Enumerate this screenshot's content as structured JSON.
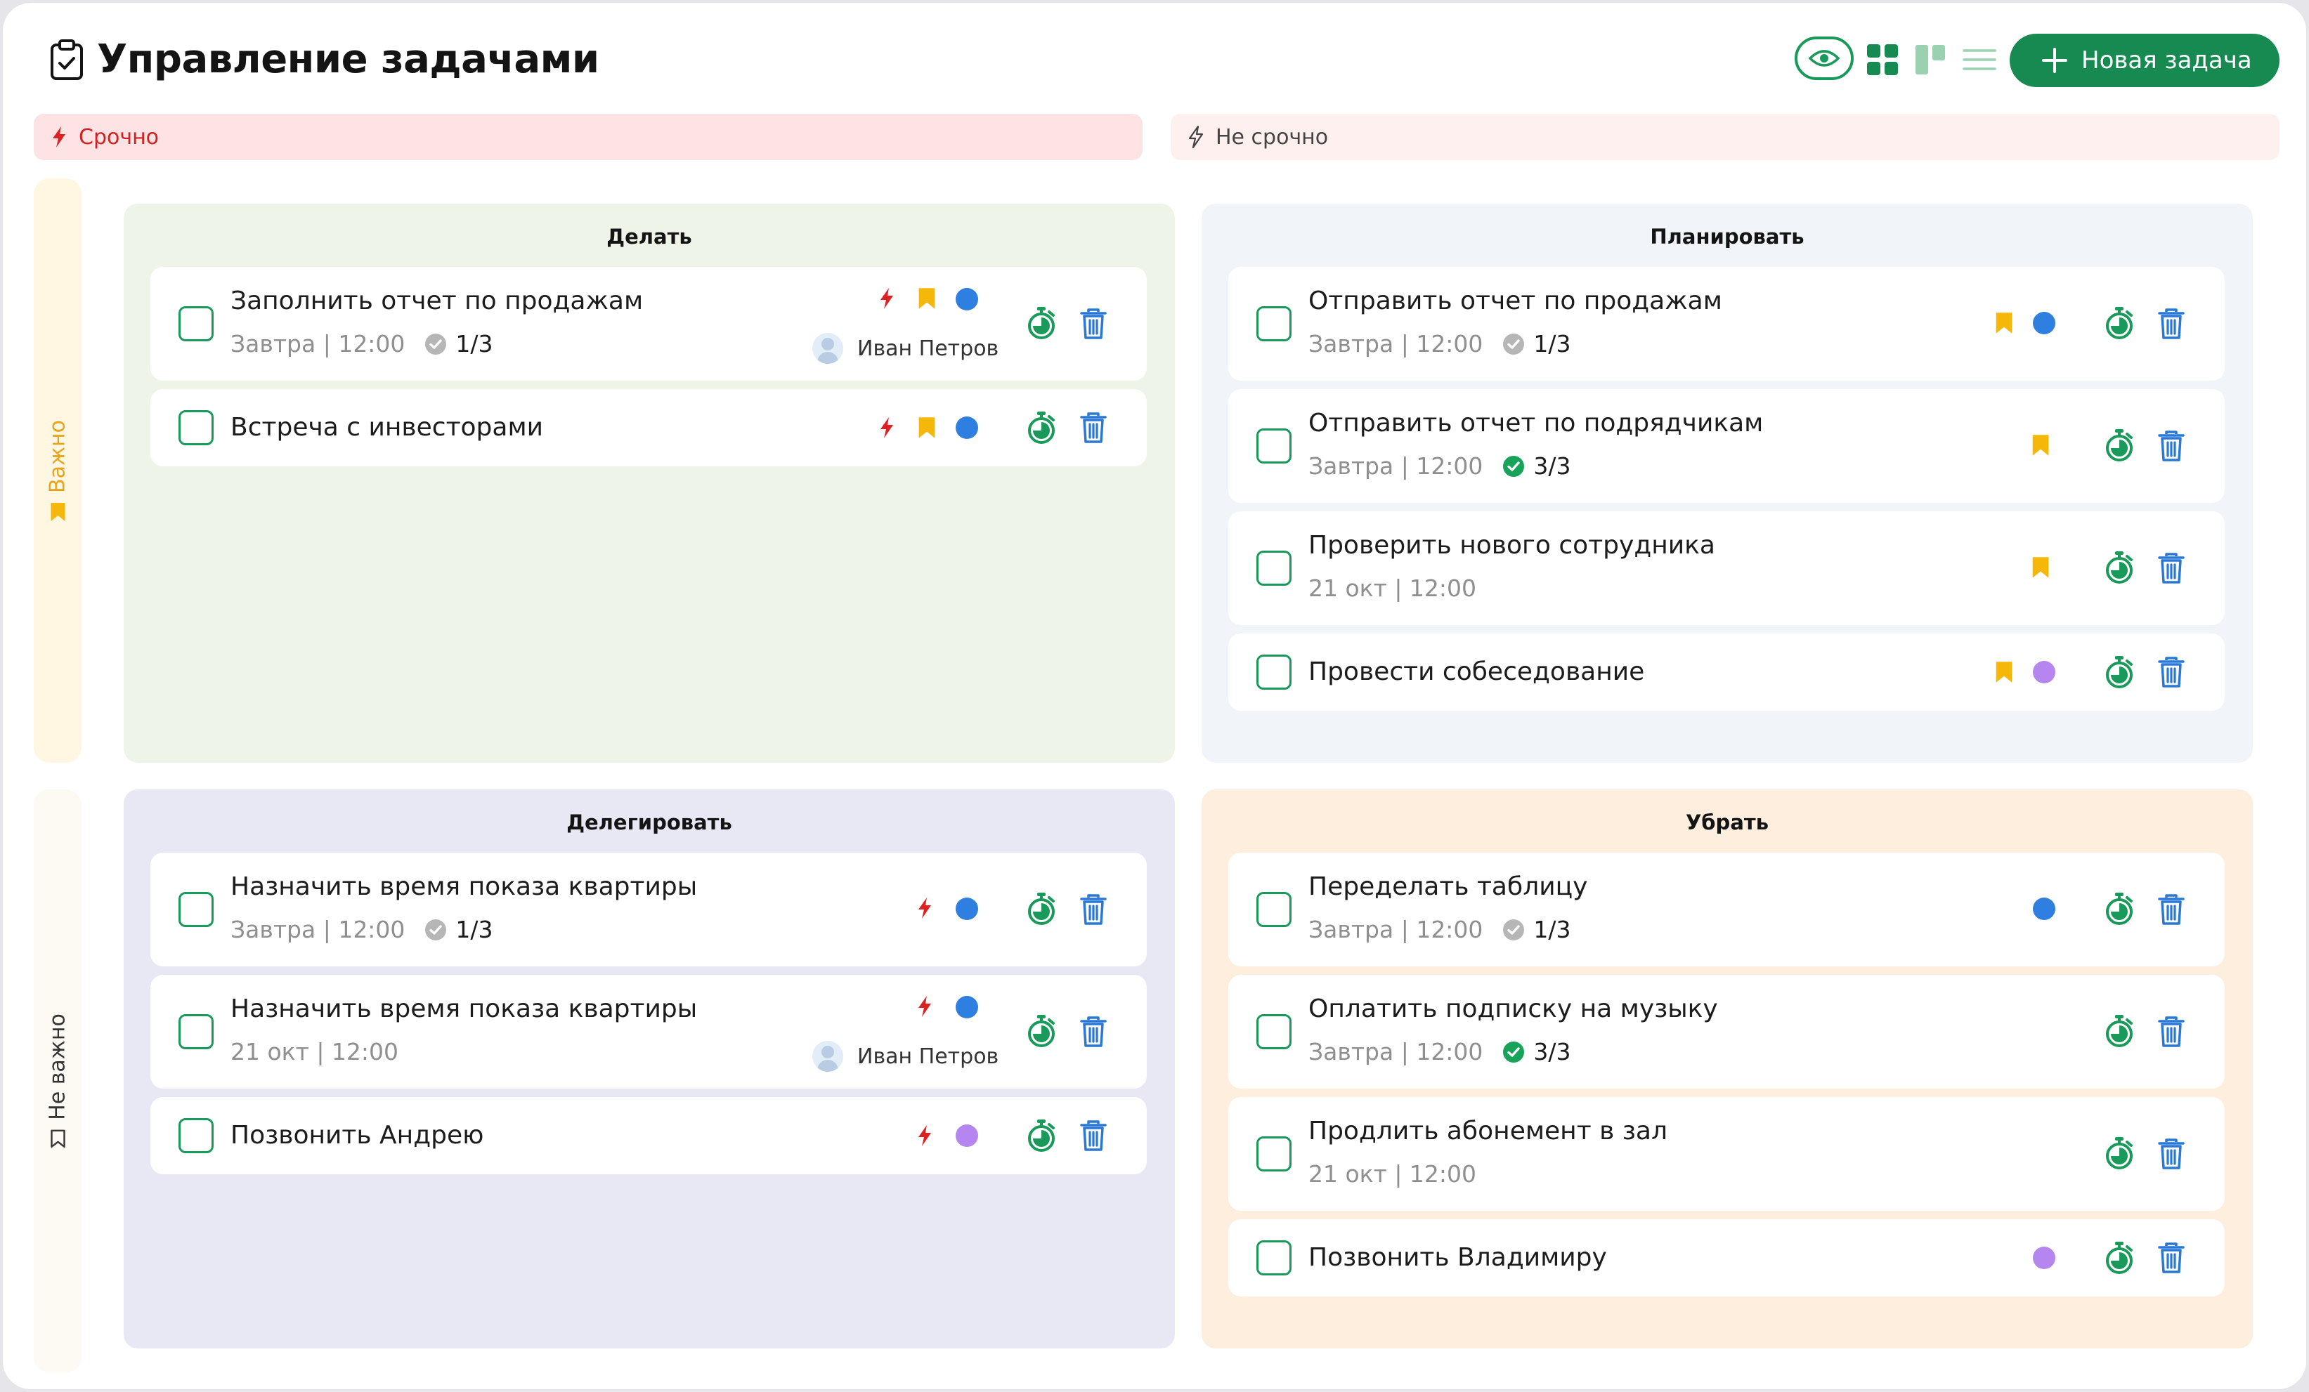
{
  "app": {
    "title": "Управление задачами",
    "new_task_label": "Новая задача",
    "views": [
      "eye-icon",
      "grid-icon",
      "board-icon",
      "list-icon"
    ]
  },
  "columns": {
    "urgent": "Срочно",
    "not_urgent": "Не срочно"
  },
  "rows": {
    "important": "Важно",
    "not_important": "Не важно"
  },
  "colors": {
    "accent": "#178a52",
    "urgent_red": "#e02020",
    "bookmark_yellow": "#f5b80a",
    "dot_blue": "#2f7fe0",
    "dot_purple": "#b586f0",
    "trash_blue": "#2a78d6"
  },
  "quadrants": {
    "do": {
      "title": "Делать",
      "tasks": [
        {
          "title": "Заполнить  отчет по продажам",
          "date": "Завтра | 12:00",
          "subtasks": "1/3",
          "subtasks_done": false,
          "urgent": true,
          "important": true,
          "dot": "blue",
          "assignee": "Иван Петров"
        },
        {
          "title": "Встреча с инвесторами",
          "urgent": true,
          "important": true,
          "dot": "blue"
        }
      ]
    },
    "plan": {
      "title": "Планировать",
      "tasks": [
        {
          "title": "Отправить отчет по продажам",
          "date": "Завтра | 12:00",
          "subtasks": "1/3",
          "subtasks_done": false,
          "important": true,
          "dot": "blue"
        },
        {
          "title": "Отправить отчет по подрядчикам",
          "date": "Завтра | 12:00",
          "subtasks": "3/3",
          "subtasks_done": true,
          "important": true
        },
        {
          "title": "Проверить нового сотрудника",
          "date": "21 окт | 12:00",
          "important": true
        },
        {
          "title": "Провести собеседование",
          "important": true,
          "dot": "purple"
        }
      ]
    },
    "delegate": {
      "title": "Делегировать",
      "tasks": [
        {
          "title": "Назначить время показа квартиры",
          "date": "Завтра | 12:00",
          "subtasks": "1/3",
          "subtasks_done": false,
          "urgent": true,
          "dot": "blue"
        },
        {
          "title": "Назначить время показа квартиры",
          "date": "21 окт | 12:00",
          "urgent": true,
          "dot": "blue",
          "assignee": "Иван Петров"
        },
        {
          "title": "Позвонить Андрею",
          "urgent": true,
          "dot": "purple"
        }
      ]
    },
    "remove": {
      "title": "Убрать",
      "tasks": [
        {
          "title": "Переделать таблицу",
          "date": "Завтра | 12:00",
          "subtasks": "1/3",
          "subtasks_done": false,
          "dot": "blue"
        },
        {
          "title": "Оплатить подписку на музыку",
          "date": "Завтра | 12:00",
          "subtasks": "3/3",
          "subtasks_done": true
        },
        {
          "title": "Продлить абонемент в зал",
          "date": "21 окт | 12:00"
        },
        {
          "title": "Позвонить Владимиру",
          "dot": "purple"
        }
      ]
    }
  }
}
